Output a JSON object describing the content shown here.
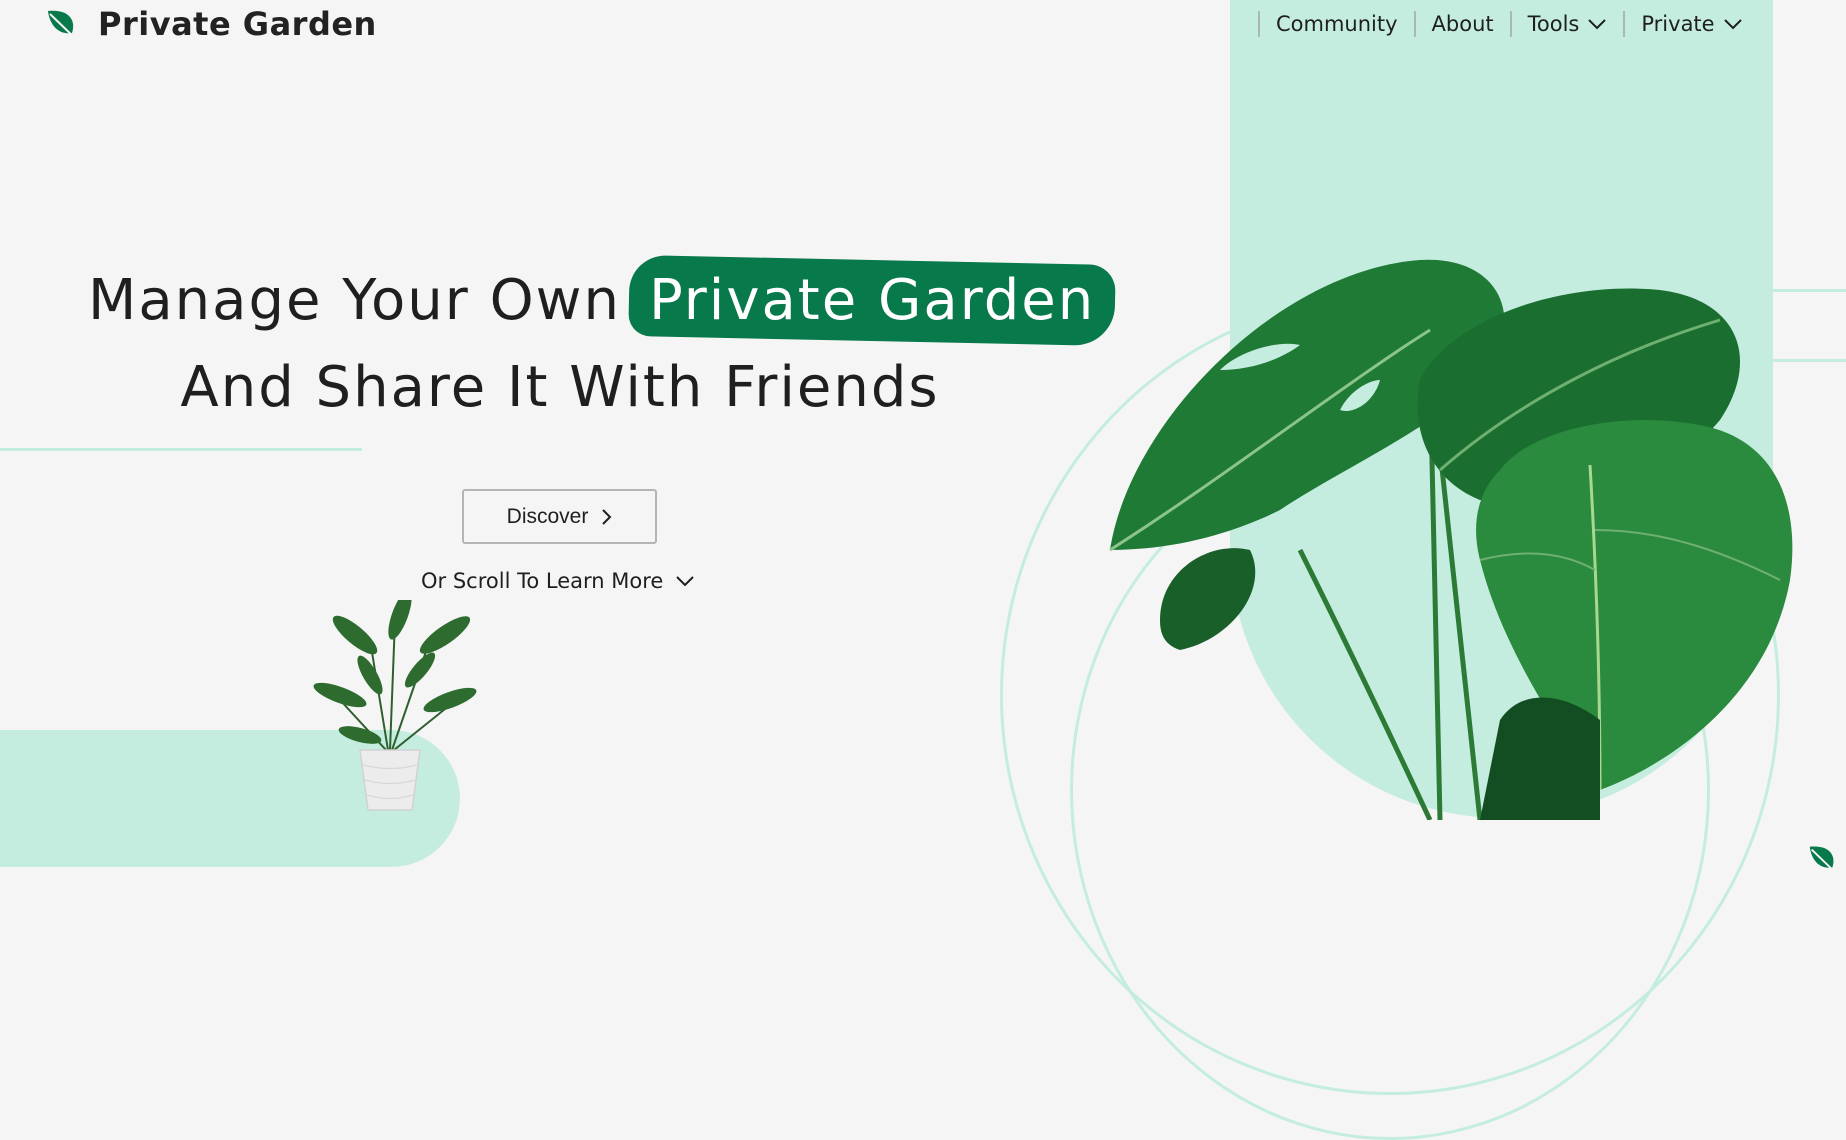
{
  "brand": {
    "name": "Private Garden",
    "icon": "leaf-icon"
  },
  "nav": {
    "items": [
      {
        "label": "Community",
        "has_dropdown": false
      },
      {
        "label": "About",
        "has_dropdown": false
      },
      {
        "label": "Tools",
        "has_dropdown": true
      },
      {
        "label": "Private",
        "has_dropdown": true
      }
    ]
  },
  "hero": {
    "line1_prefix": "Manage Your Own",
    "line1_highlight": "Private Garden",
    "line2": "And Share It With Friends",
    "discover_label": "Discover",
    "scroll_label": "Or Scroll To Learn More"
  },
  "colors": {
    "accent": "#07794a",
    "mint": "#c4ede0",
    "background": "#f5f5f5",
    "text": "#1f1f1f"
  },
  "icons": {
    "discover": "chevron-right-icon",
    "scroll": "chevron-down-icon",
    "dropdown": "chevron-down-icon",
    "corner": "leaf-icon"
  }
}
